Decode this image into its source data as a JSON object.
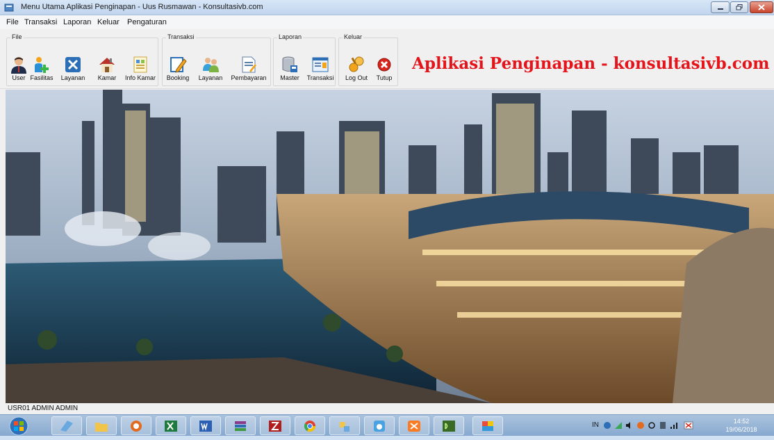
{
  "window": {
    "title": "Menu Utama Aplikasi Penginapan - Uus Rusmawan - Konsultasivb.com"
  },
  "menu": {
    "items": [
      {
        "label": "File"
      },
      {
        "label": "Transaksi"
      },
      {
        "label": "Laporan"
      },
      {
        "label": "Keluar"
      },
      {
        "label": "Pengaturan"
      }
    ]
  },
  "toolbar": {
    "groups": {
      "file": {
        "label": "File"
      },
      "transaksi": {
        "label": "Transaksi"
      },
      "laporan": {
        "label": "Laporan"
      },
      "keluar": {
        "label": "Keluar"
      }
    },
    "buttons": {
      "user": {
        "label": "User",
        "icon": "user-icon"
      },
      "fasilitas": {
        "label": "Fasilitas",
        "icon": "fasilitas-icon"
      },
      "layanan": {
        "label": "Layanan",
        "icon": "tools-icon"
      },
      "kamar": {
        "label": "Kamar",
        "icon": "house-icon"
      },
      "info_kamar": {
        "label": "Info Kamar",
        "icon": "info-icon"
      },
      "booking": {
        "label": "Booking",
        "icon": "pencil-icon"
      },
      "layanan2": {
        "label": "Layanan",
        "icon": "people-icon"
      },
      "pembayaran": {
        "label": "Pembayaran",
        "icon": "document-icon"
      },
      "master": {
        "label": "Master",
        "icon": "database-icon"
      },
      "transaksi": {
        "label": "Transaksi",
        "icon": "form-icon"
      },
      "logout": {
        "label": "Log Out",
        "icon": "keys-icon"
      },
      "tutup": {
        "label": "Tutup",
        "icon": "close-icon"
      }
    }
  },
  "brand": {
    "text": "Aplikasi Penginapan - konsultasivb.com",
    "color": "#e4141b"
  },
  "status": {
    "text": "USR01  ADMIN  ADMIN"
  },
  "taskbar": {
    "tray_lang": "IN",
    "clock_time": "14:52",
    "clock_date": "19/06/2018"
  }
}
